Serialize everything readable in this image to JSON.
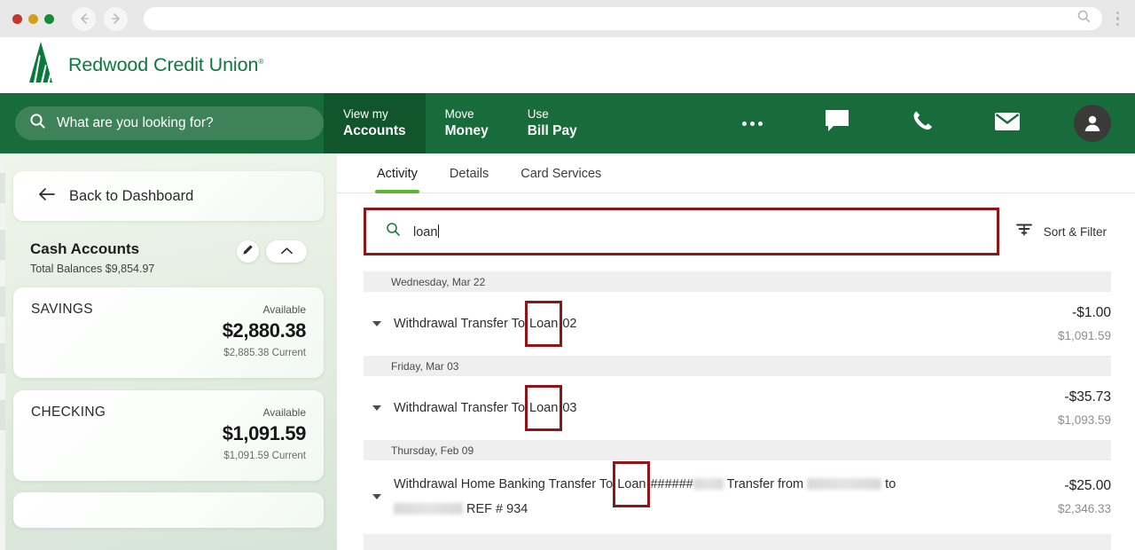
{
  "browser": {
    "back_icon": "arrow-left-icon",
    "forward_icon": "arrow-right-icon",
    "url_value": "",
    "url_search_icon": "search-icon",
    "menu_icon": "kebab-menu-icon"
  },
  "brand": {
    "name": "Redwood Credit Union",
    "trademark": "®",
    "logo_icon": "redwood-tree-logo",
    "green": "#0a7a3c"
  },
  "navbar": {
    "background": "#186b3a",
    "active_background": "#11552c",
    "search": {
      "icon": "search-icon",
      "placeholder": "What are you looking for?",
      "value": ""
    },
    "tabs": [
      {
        "line1": "View my",
        "line2": "Accounts",
        "active": true
      },
      {
        "line1": "Move",
        "line2": "Money",
        "active": false
      },
      {
        "line1": "Use",
        "line2": "Bill Pay",
        "active": false
      }
    ],
    "icons": [
      {
        "name": "more-ellipsis-icon"
      },
      {
        "name": "chat-bubble-icon"
      },
      {
        "name": "phone-icon"
      },
      {
        "name": "envelope-icon"
      },
      {
        "name": "user-avatar-icon"
      }
    ]
  },
  "sidebar": {
    "back_label": "Back to Dashboard",
    "back_icon": "arrow-left-icon",
    "section_title": "Cash Accounts",
    "total_balances": "Total Balances $9,854.97",
    "edit_icon": "pencil-icon",
    "collapse_icon": "chevron-up-icon",
    "accounts": [
      {
        "name": "SAVINGS",
        "available_label": "Available",
        "available_amount": "$2,880.38",
        "current": "$2,885.38 Current"
      },
      {
        "name": "CHECKING",
        "available_label": "Available",
        "available_amount": "$1,091.59",
        "current": "$1,091.59 Current"
      }
    ]
  },
  "main": {
    "tabs": [
      {
        "label": "Activity",
        "active": true
      },
      {
        "label": "Details",
        "active": false
      },
      {
        "label": "Card Services",
        "active": false
      }
    ],
    "search": {
      "icon": "search-icon",
      "value": "loan",
      "highlight_color": "#8e1616"
    },
    "sort_filter": {
      "label": "Sort & Filter",
      "icon": "filter-icon"
    },
    "transactions": [
      {
        "date_header": "Wednesday, Mar 22",
        "caret_icon": "caret-down-icon",
        "desc_before": "Withdrawal Transfer To ",
        "desc_highlight": "Loan",
        "desc_after": " 02",
        "amount": "-$1.00",
        "balance": "$1,091.59"
      },
      {
        "date_header": "Friday, Mar 03",
        "caret_icon": "caret-down-icon",
        "desc_before": "Withdrawal Transfer To ",
        "desc_highlight": "Loan",
        "desc_after": " 03",
        "amount": "-$35.73",
        "balance": "$1,093.59"
      },
      {
        "date_header": "Thursday, Feb 09",
        "caret_icon": "caret-down-icon",
        "desc_before": "Withdrawal Home Banking Transfer To ",
        "desc_highlight": "Loan",
        "desc_after": " ######",
        "desc_mid": " Transfer from ",
        "desc_tail": " to ",
        "desc_line2": "REF # 934",
        "amount": "-$25.00",
        "balance": "$2,346.33"
      }
    ]
  }
}
